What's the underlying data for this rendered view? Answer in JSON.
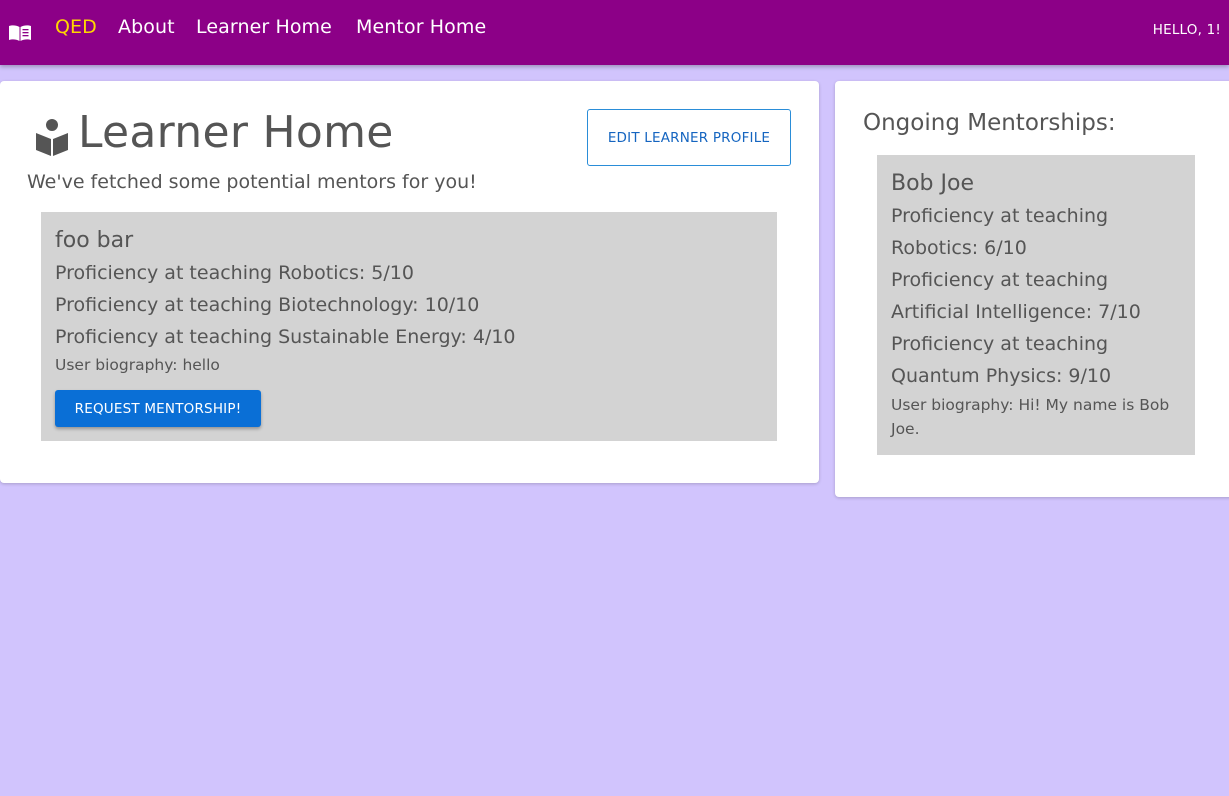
{
  "navbar": {
    "brand": "QED",
    "links": [
      "About",
      "Learner Home",
      "Mentor Home"
    ],
    "greeting": "HELLO, 1!",
    "logo_icon": "book-open-icon",
    "bg_color": "#8c0087",
    "brand_color": "#ffd700"
  },
  "learner": {
    "title_icon": "book-reader-icon",
    "title": "Learner Home",
    "subtitle": "We've fetched some potential mentors for you!",
    "edit_button": "EDIT LEARNER PROFILE",
    "mentors": [
      {
        "name": "foo bar",
        "proficiencies": [
          "Proficiency at teaching Robotics: 5/10",
          "Proficiency at teaching Biotechnology: 10/10",
          "Proficiency at teaching Sustainable Energy: 4/10"
        ],
        "biography": "User biography: hello",
        "request_button": "REQUEST MENTORSHIP!"
      }
    ]
  },
  "ongoing": {
    "title": "Ongoing Mentorships:",
    "mentorships": [
      {
        "name": "Bob Joe",
        "lines": [
          "Proficiency at teaching",
          "Robotics: 6/10",
          "Proficiency at teaching",
          "Artificial Intelligence: 7/10",
          "Proficiency at teaching",
          "Quantum Physics: 9/10"
        ],
        "biography": "User biography: Hi! My name is Bob Joe."
      }
    ]
  },
  "colors": {
    "page_bg": "#d1c4fd",
    "card_bg": "#ffffff",
    "mentor_box_bg": "#d3d3d3",
    "primary_button": "#0a6fd6"
  }
}
